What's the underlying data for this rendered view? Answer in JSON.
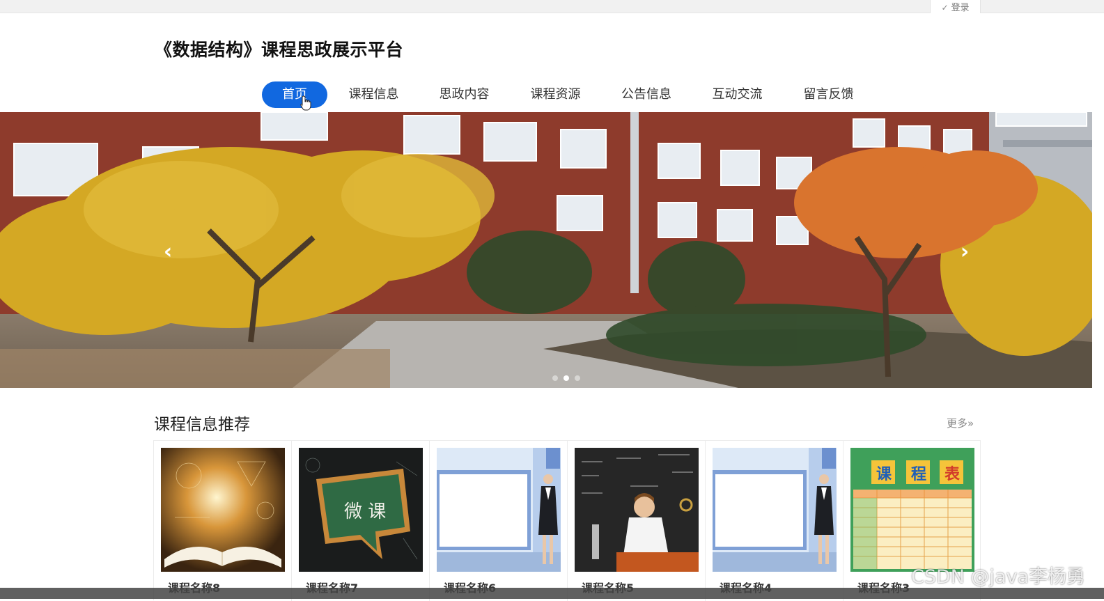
{
  "topbar": {
    "login_label": "登录",
    "login_icon": "check-circle-icon"
  },
  "header": {
    "site_title": "《数据结构》课程思政展示平台"
  },
  "nav": {
    "items": [
      {
        "label": "首页",
        "active": true
      },
      {
        "label": "课程信息",
        "active": false
      },
      {
        "label": "思政内容",
        "active": false
      },
      {
        "label": "课程资源",
        "active": false
      },
      {
        "label": "公告信息",
        "active": false
      },
      {
        "label": "互动交流",
        "active": false
      },
      {
        "label": "留言反馈",
        "active": false
      }
    ],
    "active_color": "#1168e0"
  },
  "banner": {
    "prev_icon": "chevron-left-icon",
    "next_icon": "chevron-right-icon",
    "slide_count": 3,
    "active_slide": 2,
    "prev_glyph": "‹",
    "next_glyph": "›"
  },
  "section": {
    "title": "课程信息推荐",
    "more_label": "更多»"
  },
  "courses": [
    {
      "name": "课程名称8",
      "image": "open-book-math-image"
    },
    {
      "name": "课程名称7",
      "image": "chalkboard-weike-image"
    },
    {
      "name": "课程名称6",
      "image": "presenter-slide-image"
    },
    {
      "name": "课程名称5",
      "image": "boy-blackboard-image"
    },
    {
      "name": "课程名称4",
      "image": "presenter-slide-image"
    },
    {
      "name": "课程名称3",
      "image": "timetable-image"
    }
  ],
  "weike_text": "微 课",
  "timetable_text": [
    "课",
    "程",
    "表"
  ],
  "watermark": "CSDN @java李杨勇"
}
